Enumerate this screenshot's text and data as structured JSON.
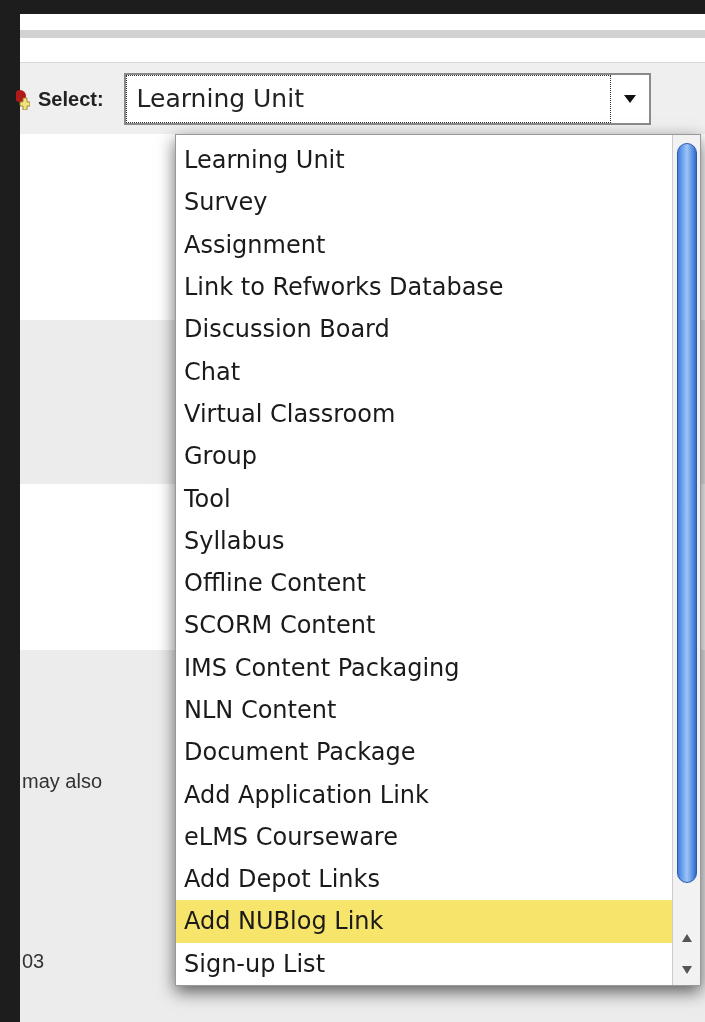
{
  "toolbar": {
    "label": "Select:",
    "select": {
      "value": "Learning Unit",
      "expanded": true
    }
  },
  "menu": {
    "options": [
      {
        "label": "Learning Unit",
        "selected": false
      },
      {
        "label": "Survey",
        "selected": false
      },
      {
        "label": "Assignment",
        "selected": false
      },
      {
        "label": "Link to Refworks Database",
        "selected": false
      },
      {
        "label": "Discussion Board",
        "selected": false
      },
      {
        "label": "Chat",
        "selected": false
      },
      {
        "label": "Virtual Classroom",
        "selected": false
      },
      {
        "label": "Group",
        "selected": false
      },
      {
        "label": "Tool",
        "selected": false
      },
      {
        "label": "Syllabus",
        "selected": false
      },
      {
        "label": "Offline Content",
        "selected": false
      },
      {
        "label": "SCORM Content",
        "selected": false
      },
      {
        "label": "IMS Content Packaging",
        "selected": false
      },
      {
        "label": "NLN Content",
        "selected": false
      },
      {
        "label": "Document Package",
        "selected": false
      },
      {
        "label": "Add Application Link",
        "selected": false
      },
      {
        "label": "eLMS Courseware",
        "selected": false
      },
      {
        "label": "Add Depot Links",
        "selected": false
      },
      {
        "label": "Add NUBlog Link",
        "selected": true
      },
      {
        "label": "Sign-up List",
        "selected": false
      }
    ]
  },
  "background_texts": [
    "may also",
    "03"
  ]
}
